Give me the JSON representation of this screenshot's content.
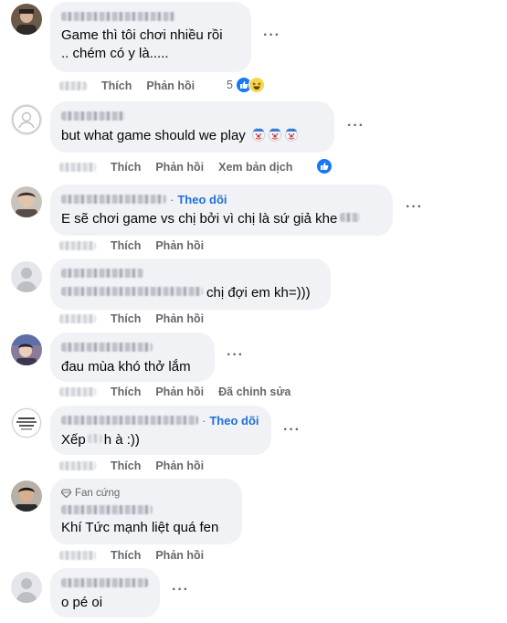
{
  "labels": {
    "like": "Thích",
    "reply": "Phản hồi",
    "more": "···",
    "follow": "Theo dõi",
    "follow_dot": "·",
    "see_translation": "Xem bản dịch",
    "edited": "Đã chỉnh sửa",
    "top_fan": "Fan cứng"
  },
  "colors": {
    "bubble": "#f0f2f5",
    "secondary_text": "#65676b",
    "link_blue": "#216fdb",
    "like_blue": "#1877f2"
  },
  "comments": [
    {
      "text_line1": "Game thì tôi chơi nhiều rồi",
      "text_line2": ".. chém có y là.....",
      "reaction_count": "5",
      "reactions": [
        "like-icon",
        "haha-icon"
      ]
    },
    {
      "text": "but what game should we play",
      "text_emojis": [
        "clown-face-icon",
        "clown-face-icon",
        "clown-face-icon"
      ],
      "reactions": [
        "like-icon"
      ]
    },
    {
      "text": "E sẽ chơi game vs chị bởi vì chị là sứ giả khe"
    },
    {
      "text": "chị đợi em kh=)))"
    },
    {
      "text": "đau mùa khó thở lắm"
    },
    {
      "text_part1": "Xếp",
      "text_part2": "h à :))"
    },
    {
      "text": "Khí Tức mạnh liệt quá fen"
    },
    {
      "text": "o pé oi"
    }
  ]
}
